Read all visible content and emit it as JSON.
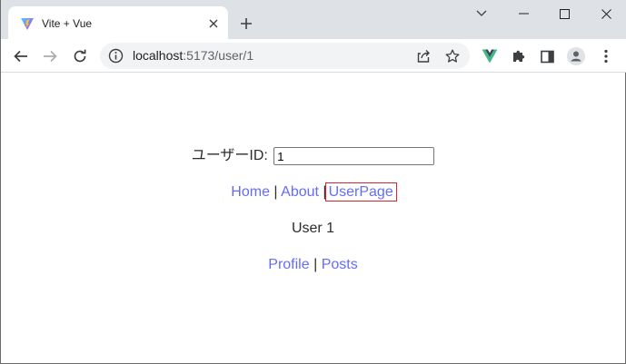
{
  "tab": {
    "title": "Vite + Vue",
    "favicon": "vite-logo-icon"
  },
  "address_bar": {
    "host": "localhost",
    "path": ":5173/user/1"
  },
  "colors": {
    "link": "#646cff",
    "active_outline": "#d9262b",
    "vue_green": "#42b883",
    "vue_dark": "#35495e"
  },
  "page": {
    "id_label": "ユーザーID:",
    "id_value": "1",
    "nav": [
      {
        "label": "Home"
      },
      {
        "label": "About"
      },
      {
        "label": "UserPage"
      }
    ],
    "separator": "|",
    "user_text": "User 1",
    "subnav": [
      {
        "label": "Profile"
      },
      {
        "label": "Posts"
      }
    ]
  }
}
